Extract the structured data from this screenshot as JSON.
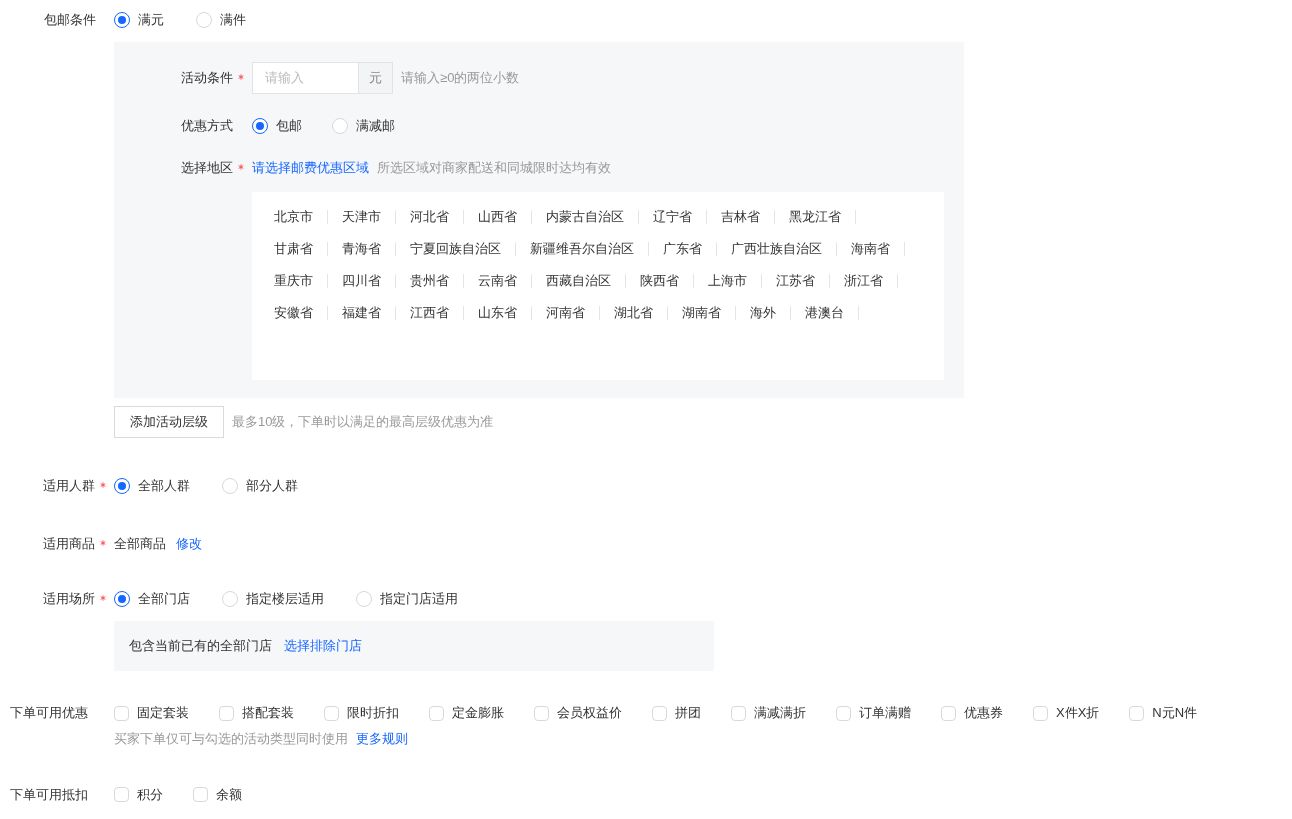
{
  "shipping_condition": {
    "label": "包邮条件",
    "options": [
      {
        "label": "满元",
        "selected": true
      },
      {
        "label": "满件",
        "selected": false
      }
    ]
  },
  "tier": {
    "activity_condition": {
      "label": "活动条件",
      "required": true,
      "placeholder": "请输入",
      "unit": "元",
      "hint": "请输入≥0的两位小数"
    },
    "discount_method": {
      "label": "优惠方式",
      "options": [
        {
          "label": "包邮",
          "selected": true
        },
        {
          "label": "满减邮",
          "selected": false
        }
      ]
    },
    "region": {
      "label": "选择地区",
      "required": true,
      "link": "请选择邮费优惠区域",
      "hint": "所选区域对商家配送和同城限时达均有效",
      "items": [
        "北京市",
        "天津市",
        "河北省",
        "山西省",
        "内蒙古自治区",
        "辽宁省",
        "吉林省",
        "黑龙江省",
        "甘肃省",
        "青海省",
        "宁夏回族自治区",
        "新疆维吾尔自治区",
        "广东省",
        "广西壮族自治区",
        "海南省",
        "重庆市",
        "四川省",
        "贵州省",
        "云南省",
        "西藏自治区",
        "陕西省",
        "上海市",
        "江苏省",
        "浙江省",
        "安徽省",
        "福建省",
        "江西省",
        "山东省",
        "河南省",
        "湖北省",
        "湖南省",
        "海外",
        "港澳台"
      ]
    }
  },
  "add_tier": {
    "button": "添加活动层级",
    "hint": "最多10级，下单时以满足的最高层级优惠为准"
  },
  "audience": {
    "label": "适用人群",
    "required": true,
    "options": [
      {
        "label": "全部人群",
        "selected": true
      },
      {
        "label": "部分人群",
        "selected": false
      }
    ]
  },
  "products": {
    "label": "适用商品",
    "required": true,
    "value": "全部商品",
    "link": "修改"
  },
  "venue": {
    "label": "适用场所",
    "required": true,
    "options": [
      {
        "label": "全部门店",
        "selected": true
      },
      {
        "label": "指定楼层适用",
        "selected": false
      },
      {
        "label": "指定门店适用",
        "selected": false
      }
    ],
    "note": "包含当前已有的全部门店",
    "link": "选择排除门店"
  },
  "order_promotions": {
    "label": "下单可用优惠",
    "options": [
      {
        "label": "固定套装",
        "checked": false
      },
      {
        "label": "搭配套装",
        "checked": false
      },
      {
        "label": "限时折扣",
        "checked": false
      },
      {
        "label": "定金膨胀",
        "checked": false
      },
      {
        "label": "会员权益价",
        "checked": false
      },
      {
        "label": "拼团",
        "checked": false
      },
      {
        "label": "满减满折",
        "checked": false
      },
      {
        "label": "订单满赠",
        "checked": false
      },
      {
        "label": "优惠券",
        "checked": false
      },
      {
        "label": "X件X折",
        "checked": false
      },
      {
        "label": "N元N件",
        "checked": false
      }
    ],
    "hint": "买家下单仅可与勾选的活动类型同时使用",
    "link": "更多规则"
  },
  "order_deductions": {
    "label": "下单可用抵扣",
    "options": [
      {
        "label": "积分",
        "checked": false
      },
      {
        "label": "余额",
        "checked": false
      }
    ]
  }
}
